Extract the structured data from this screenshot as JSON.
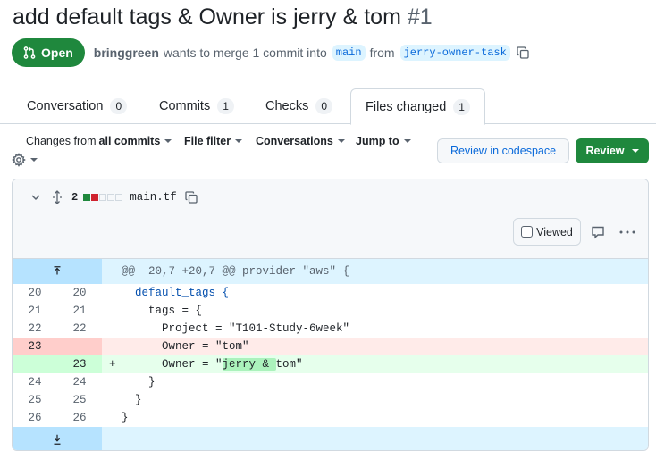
{
  "pr": {
    "title": "add default tags & Owner is jerry & tom",
    "number": "#1",
    "state": "Open",
    "author": "bringgreen",
    "summary_text": "wants to merge 1 commit into",
    "base_branch": "main",
    "from_text": "from",
    "head_branch": "jerry-owner-task"
  },
  "tabs": [
    {
      "label": "Conversation",
      "count": "0"
    },
    {
      "label": "Commits",
      "count": "1"
    },
    {
      "label": "Checks",
      "count": "0"
    },
    {
      "label": "Files changed",
      "count": "1"
    }
  ],
  "toolbar": {
    "changes_from": "Changes from",
    "all_commits": "all commits",
    "file_filter": "File filter",
    "conversations": "Conversations",
    "jump_to": "Jump to",
    "review_codespace": "Review in codespace",
    "review": "Review"
  },
  "file": {
    "changes": "2",
    "name": "main.tf",
    "viewed_label": "Viewed"
  },
  "diff": {
    "hunk": "@@ -20,7 +20,7 @@ provider \"aws\" {",
    "lines": [
      {
        "type": "ctx",
        "old": "20",
        "new": "20",
        "sign": "",
        "code": "  default_tags {"
      },
      {
        "type": "ctx",
        "old": "21",
        "new": "21",
        "sign": "",
        "code": "    tags = {"
      },
      {
        "type": "ctx",
        "old": "22",
        "new": "22",
        "sign": "",
        "code": "      Project = \"T101-Study-6week\""
      },
      {
        "type": "del",
        "old": "23",
        "new": "",
        "sign": "-",
        "code": "      Owner = \"tom\""
      },
      {
        "type": "add",
        "old": "",
        "new": "23",
        "sign": "+",
        "code_pre": "      Owner = \"",
        "code_hl": "jerry & ",
        "code_post": "tom\""
      },
      {
        "type": "ctx",
        "old": "24",
        "new": "24",
        "sign": "",
        "code": "    }"
      },
      {
        "type": "ctx",
        "old": "25",
        "new": "25",
        "sign": "",
        "code": "  }"
      },
      {
        "type": "ctx",
        "old": "26",
        "new": "26",
        "sign": "",
        "code": "}"
      }
    ]
  },
  "icons": {
    "state": "git-pull-request-icon",
    "copy": "copy-icon",
    "gear": "gear-icon",
    "collapse": "chevron-down-icon",
    "expand": "unfold-icon",
    "comment": "comment-icon",
    "more": "kebab-horizontal-icon"
  },
  "colors": {
    "open_green": "#1f883d",
    "link_blue": "#0969da",
    "deletion_bg": "#ffebe9",
    "addition_bg": "#e6ffec",
    "hunk_bg": "#ddf4ff"
  }
}
